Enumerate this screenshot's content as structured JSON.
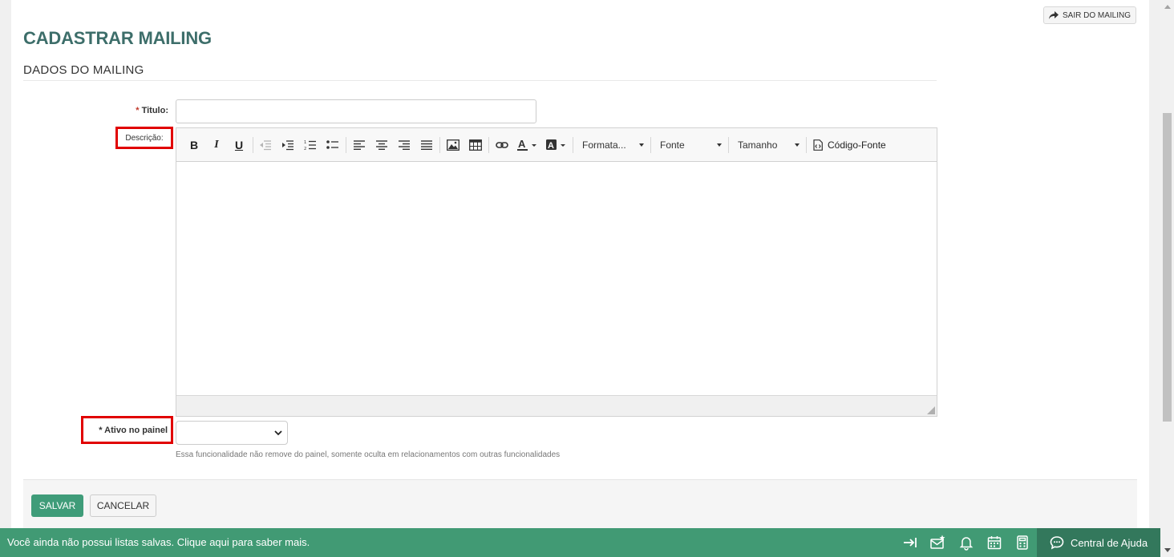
{
  "header": {
    "exit_label": "SAIR DO MAILING",
    "page_title": "CADASTRAR MAILING",
    "section_title": "DADOS DO MAILING"
  },
  "form": {
    "title_label": "Titulo:",
    "title_required": "*",
    "title_value": "",
    "description_label": "Descrição:",
    "active_label": "* Ativo no painel",
    "active_value": "",
    "active_help": "Essa funcionalidade não remove do painel, somente oculta em relacionamentos com outras funcionalidades"
  },
  "editor": {
    "bold": "B",
    "italic": "I",
    "underline": "U",
    "format_combo": "Formata...",
    "font_combo": "Fonte",
    "size_combo": "Tamanho",
    "source_label": "Código-Fonte"
  },
  "footer": {
    "save_label": "SALVAR",
    "cancel_label": "CANCELAR"
  },
  "bottom_bar": {
    "message": "Você ainda não possui listas salvas. Clique aqui para saber mais.",
    "help_center_label": "Central de Ajuda"
  },
  "colors": {
    "title_teal": "#3d6e6a",
    "primary_green": "#3f9c79",
    "bar_green": "#419a74",
    "help_dark_green": "#33785c",
    "highlight_red": "#e10000"
  }
}
